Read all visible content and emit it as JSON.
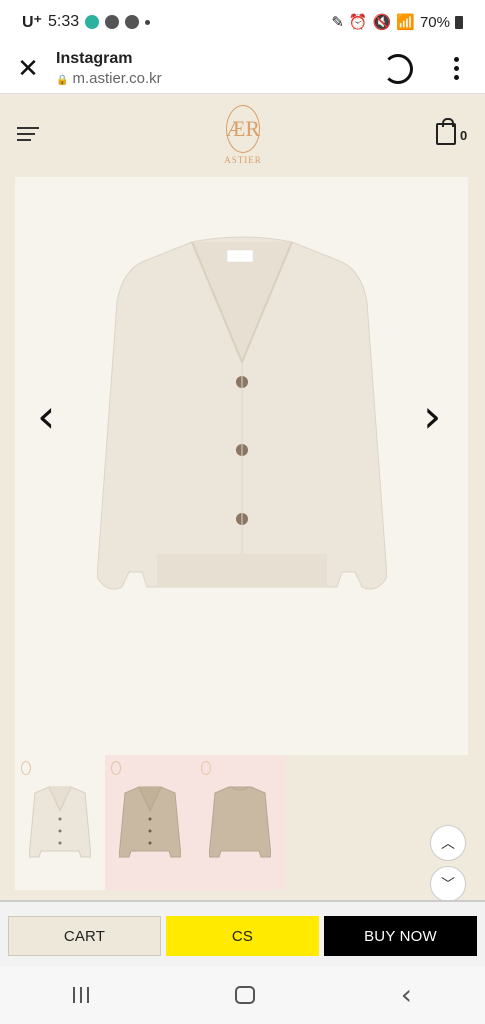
{
  "status_bar": {
    "carrier": "U⁺",
    "time": "5:33",
    "battery": "70%"
  },
  "browser": {
    "title": "Instagram",
    "url": "m.astier.co.kr"
  },
  "site": {
    "brand": "ASTIER",
    "cart_count": "0"
  },
  "gallery": {
    "thumb_count": 3
  },
  "actions": {
    "cart_label": "CART",
    "cs_label": "CS",
    "buy_label": "BUY NOW"
  },
  "colors": {
    "page_bg": "#efeadb",
    "cs_button": "#ffea00",
    "buy_button": "#000000",
    "logo": "#d9a06b"
  }
}
